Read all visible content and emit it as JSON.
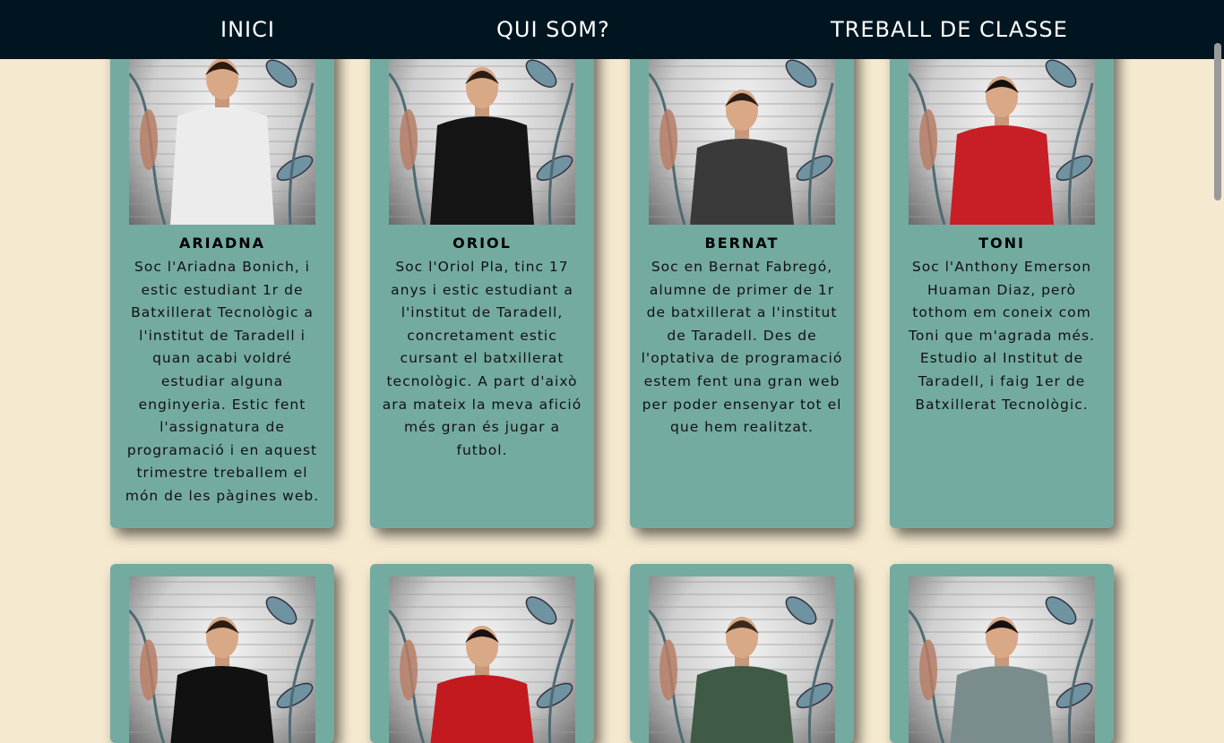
{
  "nav": {
    "items": [
      {
        "label": "INICI"
      },
      {
        "label": "QUI SOM?"
      },
      {
        "label": "TREBALL DE CLASSE"
      }
    ]
  },
  "students": [
    {
      "name": "ARIADNA",
      "bio": "Soc l'Ariadna Bonich, i estic estudiant 1r de Batxillerat Tecnològic a l'institut de Taradell i quan acabi voldré estudiar alguna enginyeria. Estic fent l'assignatura de programació i en aquest trimestre treballem el món de les pàgines web.",
      "shirt": "#ececec",
      "hair": "#2a1a12"
    },
    {
      "name": "ORIOL",
      "bio": "Soc l'Oriol Pla, tinc 17 anys i estic estudiant a l'institut de Taradell, concretament estic cursant el batxillerat tecnològic. A part d'això ara mateix la meva afició més gran és jugar a futbol.",
      "shirt": "#151515",
      "hair": "#2b1d14"
    },
    {
      "name": "BERNAT",
      "bio": "Soc en Bernat Fabregó, alumne de primer de 1r de batxillerat a l'institut de Taradell. Des de l'optativa de programació estem fent una gran web per poder ensenyar tot el que hem realitzat.",
      "shirt": "#3a3a3a",
      "hair": "#2b1d14"
    },
    {
      "name": "TONI",
      "bio": "Soc l'Anthony Emerson Huaman Diaz, però tothom em coneix com Toni que m'agrada més. Estudio al Institut de Taradell, i faig 1er de Batxillerat Tecnològic.",
      "shirt": "#c81e25",
      "hair": "#151010"
    }
  ],
  "students_row2": [
    {
      "shirt": "#111111",
      "hair": "#2b1d14"
    },
    {
      "shirt": "#c21a1f",
      "hair": "#1a1010"
    },
    {
      "shirt": "#3f5a45",
      "hair": "#3a2a1e"
    },
    {
      "shirt": "#7a8c8c",
      "hair": "#151010"
    }
  ],
  "colors": {
    "nav_bg": "#011520",
    "page_bg": "#f5e9cf",
    "card_bg": "#74aba1"
  }
}
